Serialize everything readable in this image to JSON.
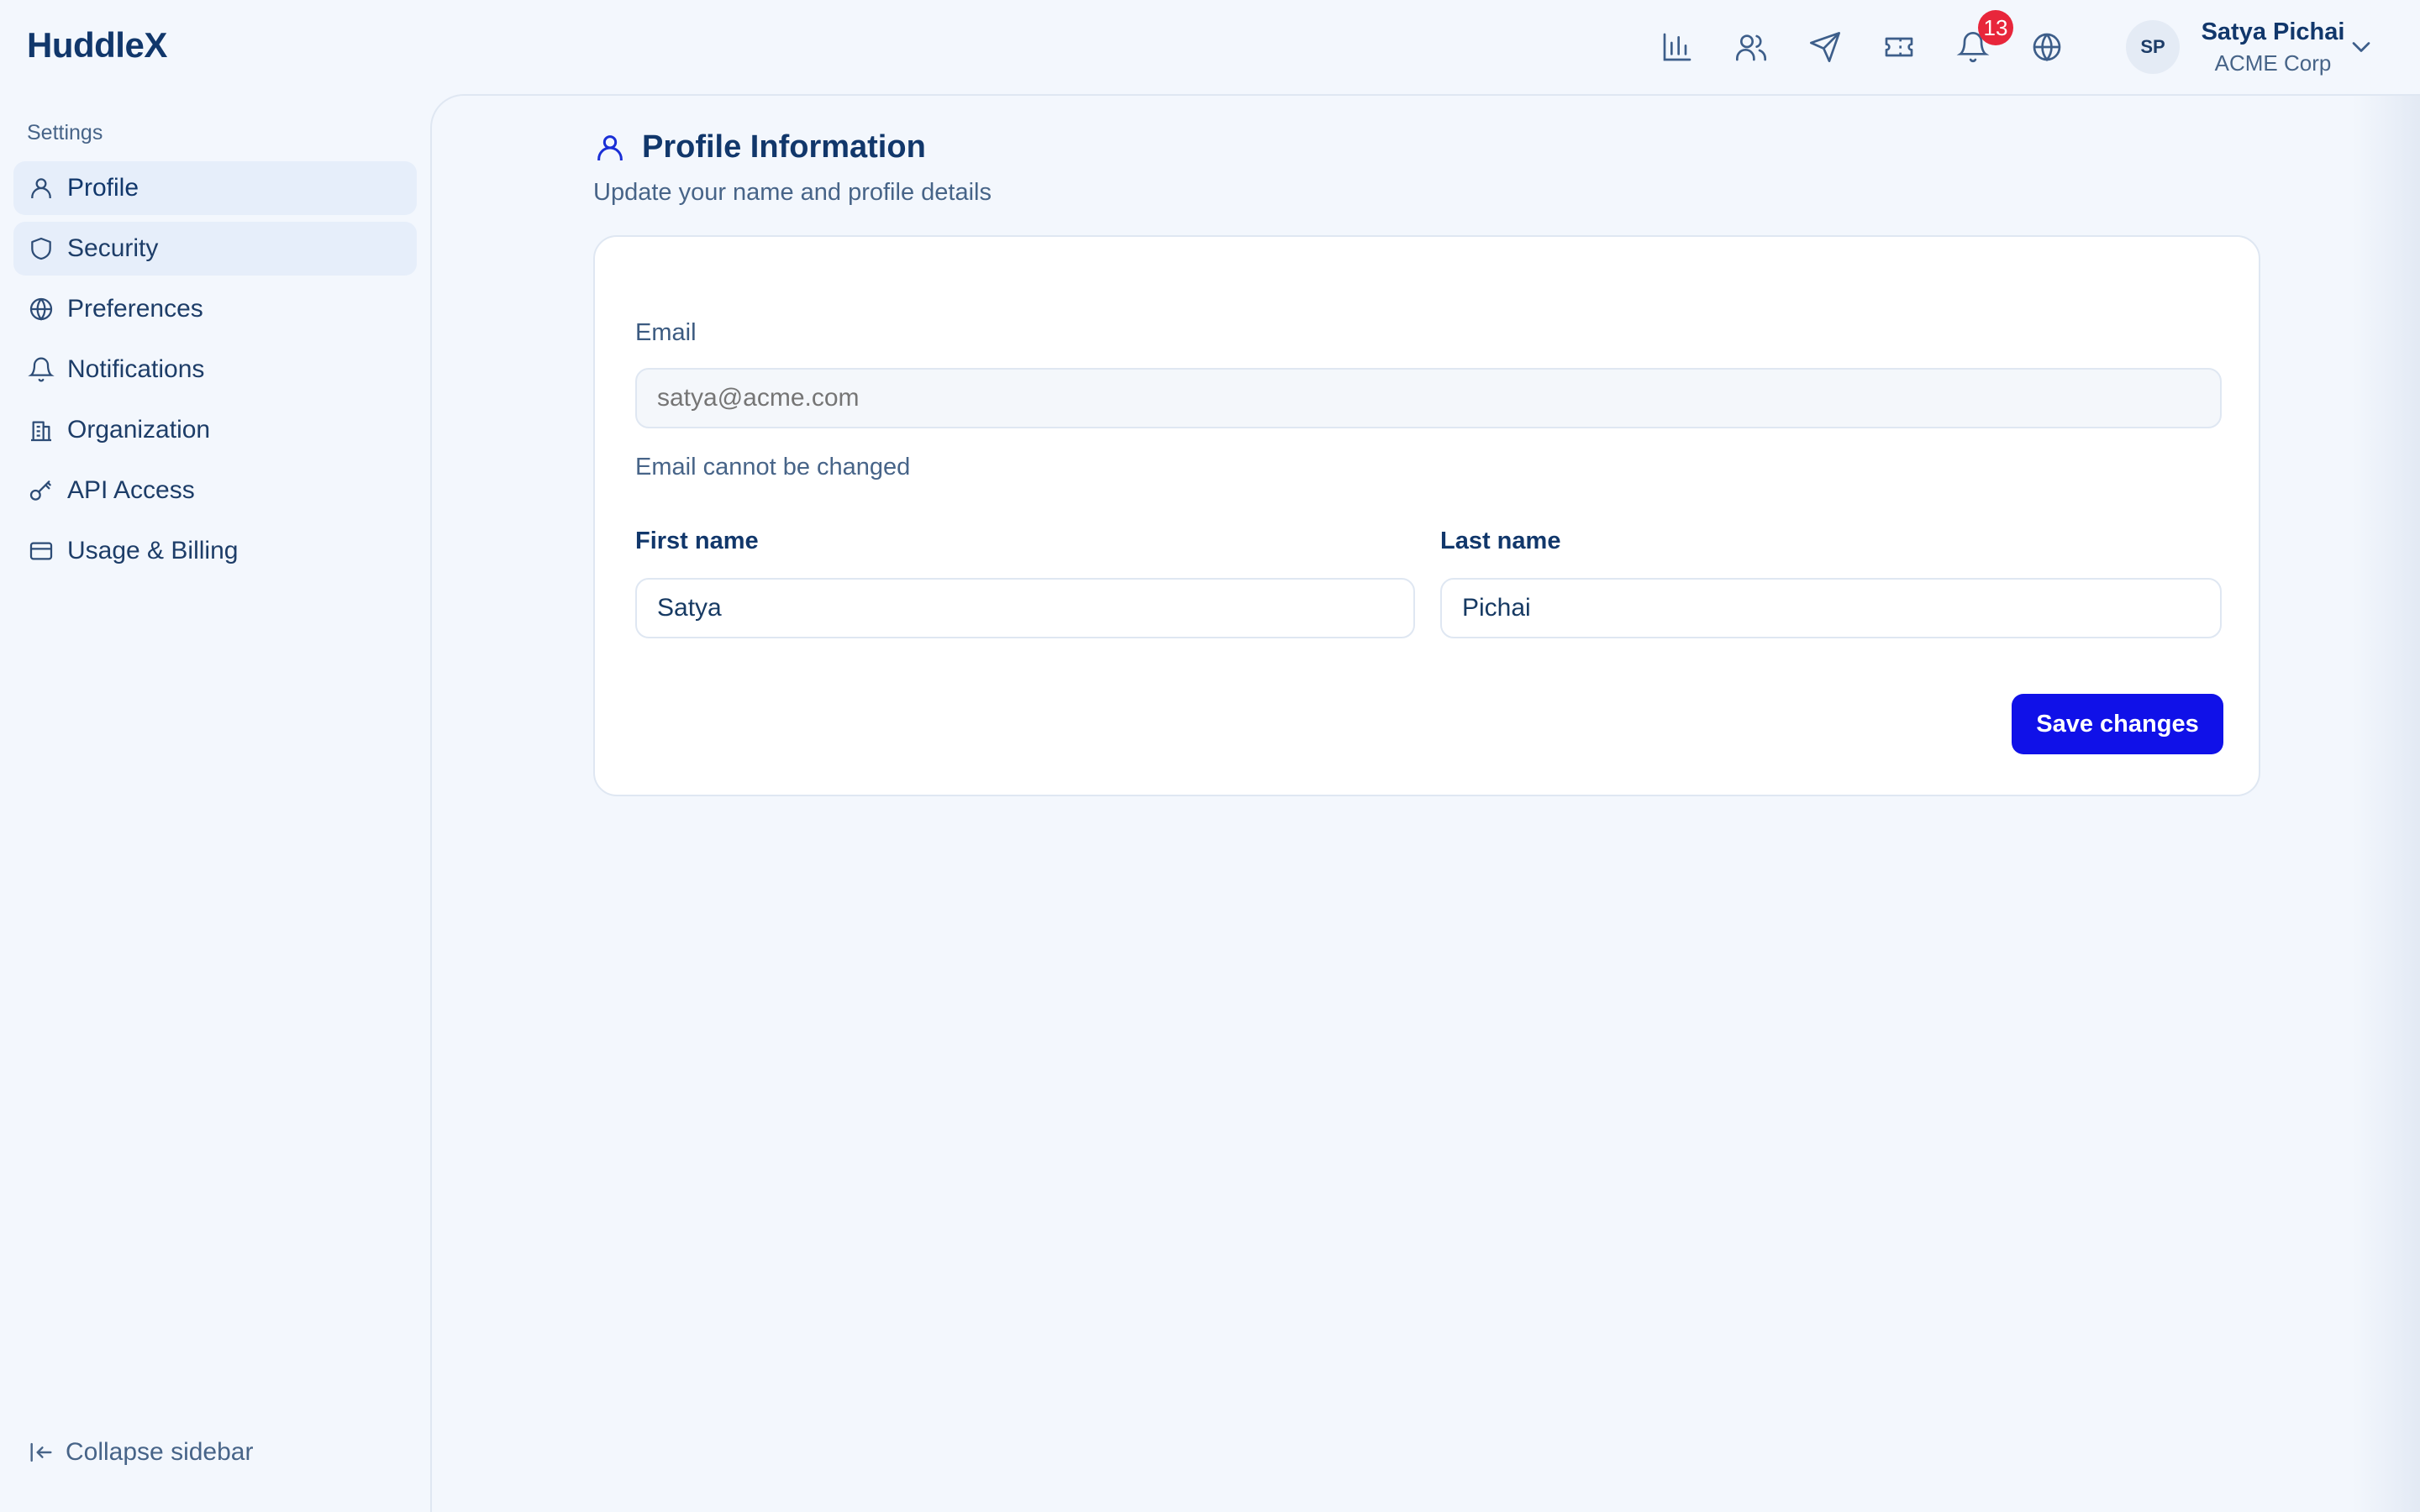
{
  "app": {
    "name": "HuddleX"
  },
  "header": {
    "nav_icons": [
      "bar-chart-icon",
      "users-icon",
      "send-icon",
      "ticket-icon",
      "bell-icon",
      "globe-icon"
    ],
    "notification_count": "13",
    "user": {
      "initials": "SP",
      "name": "Satya Pichai",
      "org": "ACME Corp"
    }
  },
  "sidebar": {
    "title": "Settings",
    "items": [
      {
        "label": "Profile",
        "icon": "user-icon",
        "active": true
      },
      {
        "label": "Security",
        "icon": "shield-icon",
        "active": false
      },
      {
        "label": "Preferences",
        "icon": "globe-icon",
        "active": false
      },
      {
        "label": "Notifications",
        "icon": "bell-icon",
        "active": false
      },
      {
        "label": "Organization",
        "icon": "building-icon",
        "active": false
      },
      {
        "label": "API Access",
        "icon": "key-icon",
        "active": false
      },
      {
        "label": "Usage & Billing",
        "icon": "credit-card-icon",
        "active": false
      }
    ],
    "collapse_label": "Collapse sidebar"
  },
  "main": {
    "title": "Profile Information",
    "subtitle": "Update your name and profile details",
    "form": {
      "email_label": "Email",
      "email_placeholder": "satya@acme.com",
      "email_helper": "Email cannot be changed",
      "first_name_label": "First name",
      "first_name_value": "Satya",
      "last_name_label": "Last name",
      "last_name_value": "Pichai",
      "save_label": "Save changes"
    }
  },
  "colors": {
    "background": "#f3f7fd",
    "primary": "#1011e8",
    "text": "#11376b",
    "badge": "#e8263b"
  }
}
